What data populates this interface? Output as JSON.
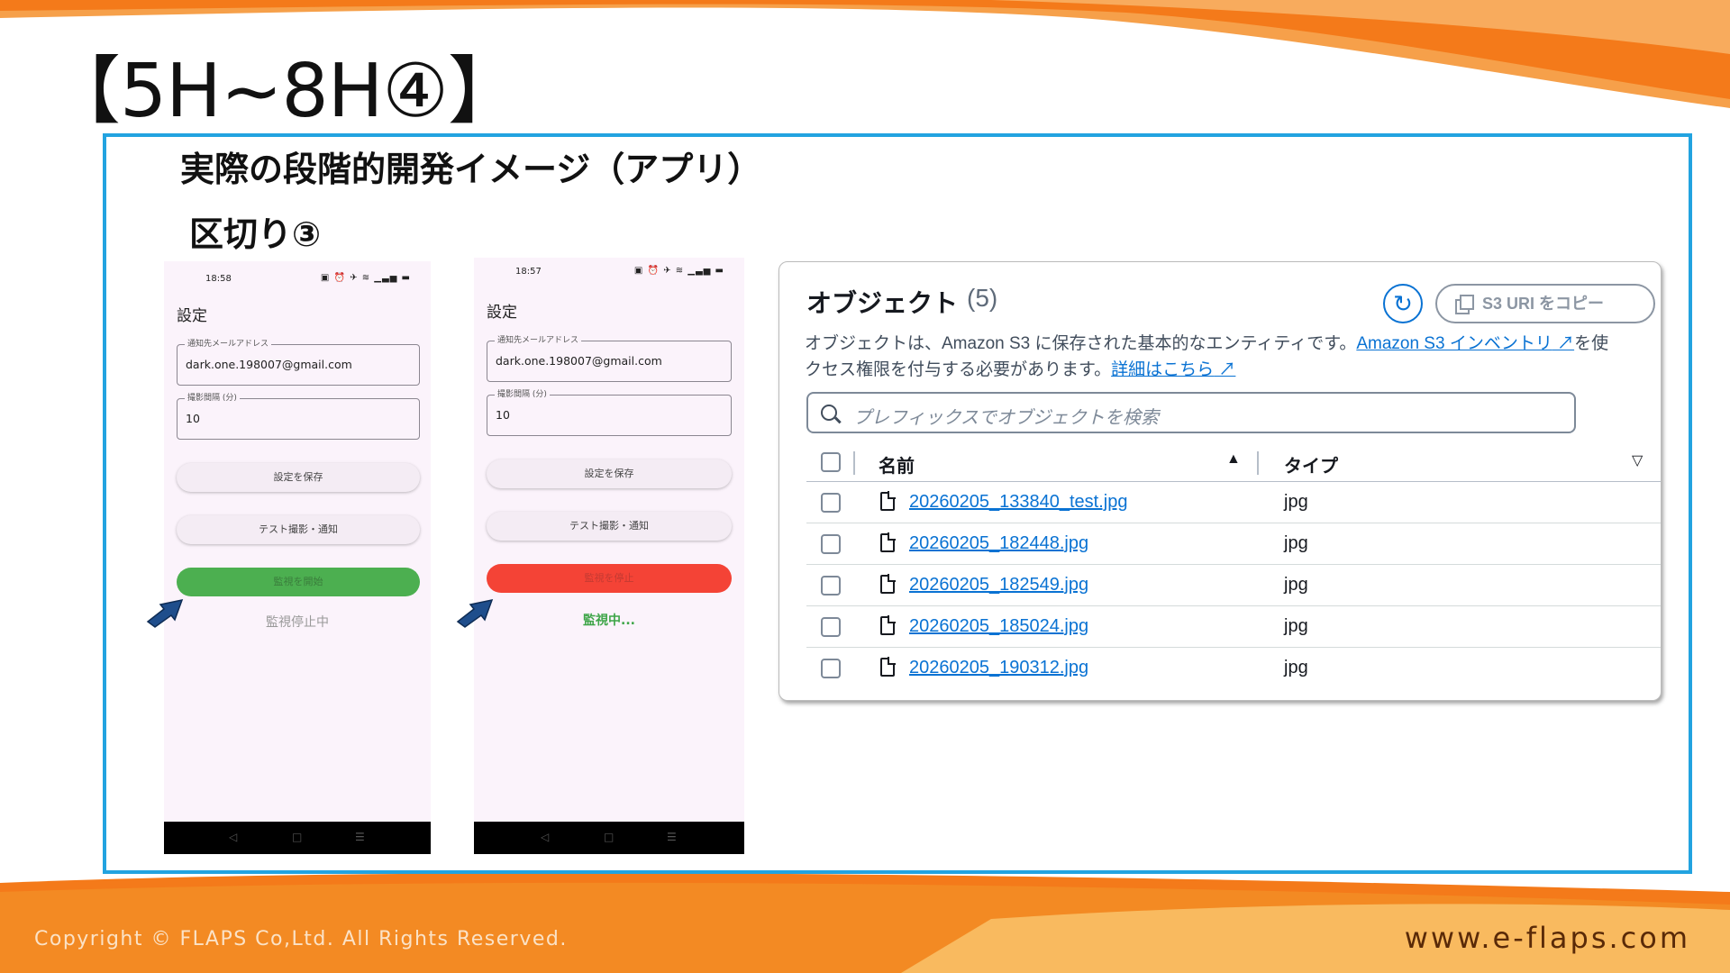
{
  "slide": {
    "title": "【5H~8H④】",
    "heading": "実際の段階的開発イメージ（アプリ）",
    "subheading": "区切り③",
    "colors": {
      "frame": "#22a3e0",
      "accent_orange": "#f47a1a"
    }
  },
  "phone_a": {
    "time": "18:58",
    "status_icons": "▣ ⏰ ✈ ≋ ▁▃▅ ▬",
    "title": "設定",
    "email_label": "通知先メールアドレス",
    "email_value": "dark.one.198007@gmail.com",
    "interval_label": "撮影間隔 (分)",
    "interval_value": "10",
    "save_button": "設定を保存",
    "test_button": "テスト撮影・通知",
    "monitor_button": "監視を開始",
    "monitor_status": "監視停止中",
    "nav": [
      "◁",
      "□",
      "☰"
    ]
  },
  "phone_b": {
    "time": "18:57",
    "status_icons": "▣ ⏰ ✈ ≋ ▁▃▅ ▬",
    "title": "設定",
    "email_label": "通知先メールアドレス",
    "email_value": "dark.one.198007@gmail.com",
    "interval_label": "撮影間隔 (分)",
    "interval_value": "10",
    "save_button": "設定を保存",
    "test_button": "テスト撮影・通知",
    "monitor_button": "監視を停止",
    "monitor_status": "監視中...",
    "nav": [
      "◁",
      "□",
      "☰"
    ]
  },
  "s3": {
    "title": "オブジェクト",
    "count": "(5)",
    "refresh_icon": "refresh-icon",
    "copy_uri_button": "S3 URI をコピー",
    "description_line1": "オブジェクトは、Amazon S3 に保存された基本的なエンティティです。",
    "inventory_link": "Amazon S3 インベントリ",
    "description_line1_tail": "を使",
    "description_line2": "クセス権限を付与する必要があります。",
    "learn_more_link": "詳細はこちら",
    "search_placeholder": "プレフィックスでオブジェクトを検索",
    "columns": {
      "name": "名前",
      "type": "タイプ"
    },
    "objects": [
      {
        "name": "20260205_133840_test.jpg",
        "type": "jpg"
      },
      {
        "name": "20260205_182448.jpg",
        "type": "jpg"
      },
      {
        "name": "20260205_182549.jpg",
        "type": "jpg"
      },
      {
        "name": "20260205_185024.jpg",
        "type": "jpg"
      },
      {
        "name": "20260205_190312.jpg",
        "type": "jpg"
      }
    ]
  },
  "footer": {
    "copyright": "Copyright © FLAPS Co,Ltd. All Rights Reserved.",
    "url": "www.e-flaps.com"
  }
}
